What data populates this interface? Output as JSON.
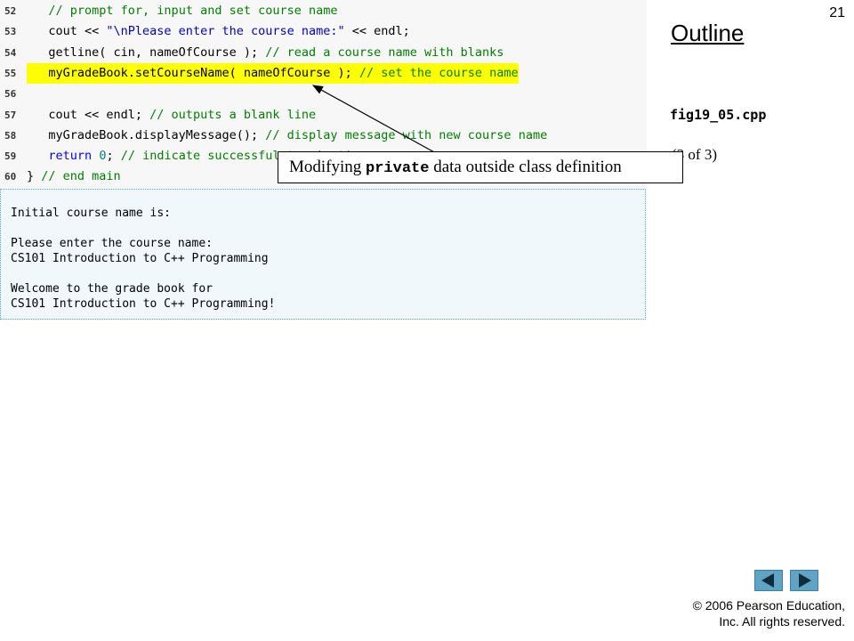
{
  "slide": {
    "number": "21"
  },
  "outline": {
    "title": "Outline",
    "file_name": "fig19_05.cpp",
    "page_indicator": "(3 of 3)"
  },
  "code": {
    "lines": [
      {
        "no": "52",
        "parts": [
          {
            "t": "   "
          },
          {
            "t": "// prompt for, input and set course name",
            "c": "comment"
          }
        ]
      },
      {
        "no": "53",
        "parts": [
          {
            "t": "   cout << "
          },
          {
            "t": "\"\\nPlease enter the course name:\"",
            "c": "string"
          },
          {
            "t": " << endl;"
          }
        ]
      },
      {
        "no": "54",
        "parts": [
          {
            "t": "   getline( cin, nameOfCourse ); "
          },
          {
            "t": "// read a course name with blanks",
            "c": "comment"
          }
        ]
      },
      {
        "no": "55",
        "highlight": true,
        "parts": [
          {
            "t": "   myGradeBook.setCourseName( nameOfCourse ); "
          },
          {
            "t": "// set the course name",
            "c": "comment"
          }
        ]
      },
      {
        "no": "56",
        "parts": [
          {
            "t": ""
          }
        ]
      },
      {
        "no": "57",
        "parts": [
          {
            "t": "   cout << endl; "
          },
          {
            "t": "// outputs a blank line",
            "c": "comment"
          }
        ]
      },
      {
        "no": "58",
        "parts": [
          {
            "t": "   myGradeBook.displayMessage(); "
          },
          {
            "t": "// display message with new course name",
            "c": "comment"
          }
        ]
      },
      {
        "no": "59",
        "parts": [
          {
            "t": "   "
          },
          {
            "t": "return",
            "c": "keyword"
          },
          {
            "t": " "
          },
          {
            "t": "0",
            "c": "number"
          },
          {
            "t": "; "
          },
          {
            "t": "// indicate successful termination",
            "c": "comment"
          }
        ]
      },
      {
        "no": "60",
        "parts": [
          {
            "t": "} "
          },
          {
            "t": "// end main",
            "c": "comment"
          }
        ]
      }
    ]
  },
  "output": {
    "lines": [
      "Initial course name is:",
      "",
      "Please enter the course name:",
      "CS101 Introduction to C++ Programming",
      "",
      "Welcome to the grade book for",
      "CS101 Introduction to C++ Programming!"
    ]
  },
  "callout": {
    "before": "Modifying ",
    "code": "private",
    "after": " data outside class definition"
  },
  "nav": {
    "prev_icon": "left-triangle-icon",
    "next_icon": "right-triangle-icon"
  },
  "copyright": {
    "line1": "© 2006 Pearson Education,",
    "line2": "Inc.  All rights reserved."
  }
}
